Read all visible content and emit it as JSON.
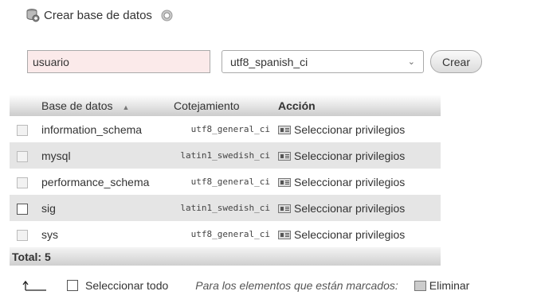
{
  "create_section": {
    "title": "Crear base de datos",
    "db_name_value": "usuario",
    "collation_selected": "utf8_spanish_ci",
    "create_button_label": "Crear"
  },
  "table": {
    "headers": {
      "name": "Base de datos",
      "collation": "Cotejamiento",
      "action": "Acción"
    },
    "rows": [
      {
        "name": "information_schema",
        "collation": "utf8_general_ci",
        "action": "Seleccionar privilegios"
      },
      {
        "name": "mysql",
        "collation": "latin1_swedish_ci",
        "action": "Seleccionar privilegios"
      },
      {
        "name": "performance_schema",
        "collation": "utf8_general_ci",
        "action": "Seleccionar privilegios"
      },
      {
        "name": "sig",
        "collation": "latin1_swedish_ci",
        "action": "Seleccionar privilegios"
      },
      {
        "name": "sys",
        "collation": "utf8_general_ci",
        "action": "Seleccionar privilegios"
      }
    ],
    "total_label": "Total: 5"
  },
  "footer": {
    "select_all_label": "Seleccionar todo",
    "marked_label": "Para los elementos que están marcados:",
    "delete_label": "Eliminar"
  },
  "icons": {
    "header": "database-add-icon",
    "help": "help-icon",
    "privileges": "privileges-icon",
    "arrow": "arrow-up-icon",
    "delete": "delete-icon"
  }
}
